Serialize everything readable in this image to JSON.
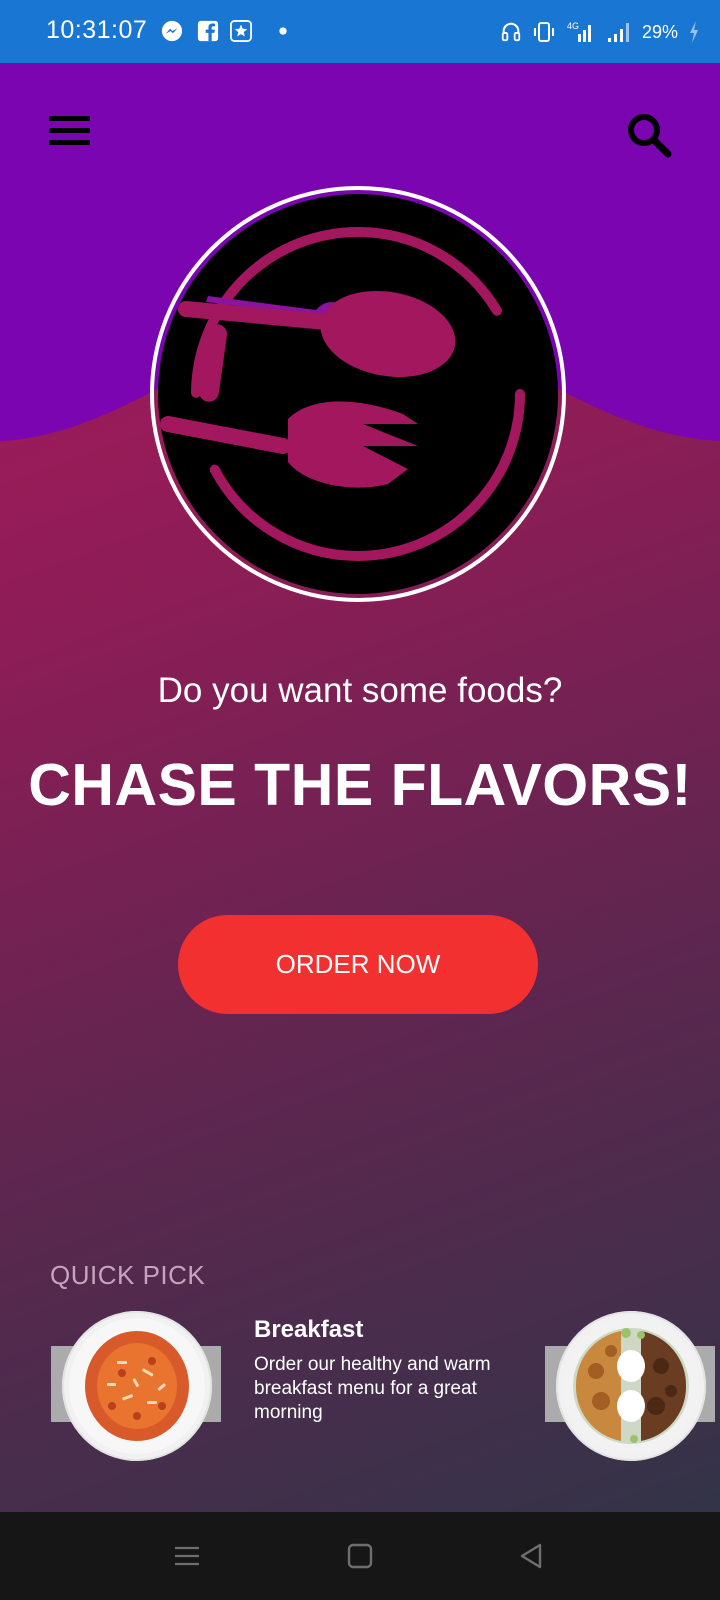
{
  "status_bar": {
    "time": "10:31:07",
    "left_icons": [
      "messenger-icon",
      "facebook-icon",
      "star-badge-icon",
      "dot-icon"
    ],
    "right_icons": [
      "headphones-icon",
      "vibrate-icon",
      "signal-4g-icon",
      "signal-icon",
      "battery-charging-icon"
    ],
    "network": "4G",
    "battery": "29%"
  },
  "header": {
    "menu_icon": "hamburger-menu-icon",
    "search_icon": "search-icon",
    "logo_icon": "plate-fork-spoon-logo"
  },
  "hero": {
    "tagline": "Do you want some foods?",
    "headline": "CHASE THE FLAVORS!",
    "order_button": "ORDER NOW"
  },
  "quick_pick": {
    "label": "QUICK PICK",
    "item": {
      "title": "Breakfast",
      "description": "Order our healthy and warm breakfast menu for a great morning"
    }
  },
  "colors": {
    "status_bar": "#1976d2",
    "header_purple": "#7b05b0",
    "gradient_top": "#b0185f",
    "gradient_bottom": "#333448",
    "order_button": "#f23030",
    "nav_bar": "#161616"
  },
  "nav_bar": {
    "icons": [
      "recent-apps-icon",
      "home-icon",
      "back-icon"
    ]
  }
}
